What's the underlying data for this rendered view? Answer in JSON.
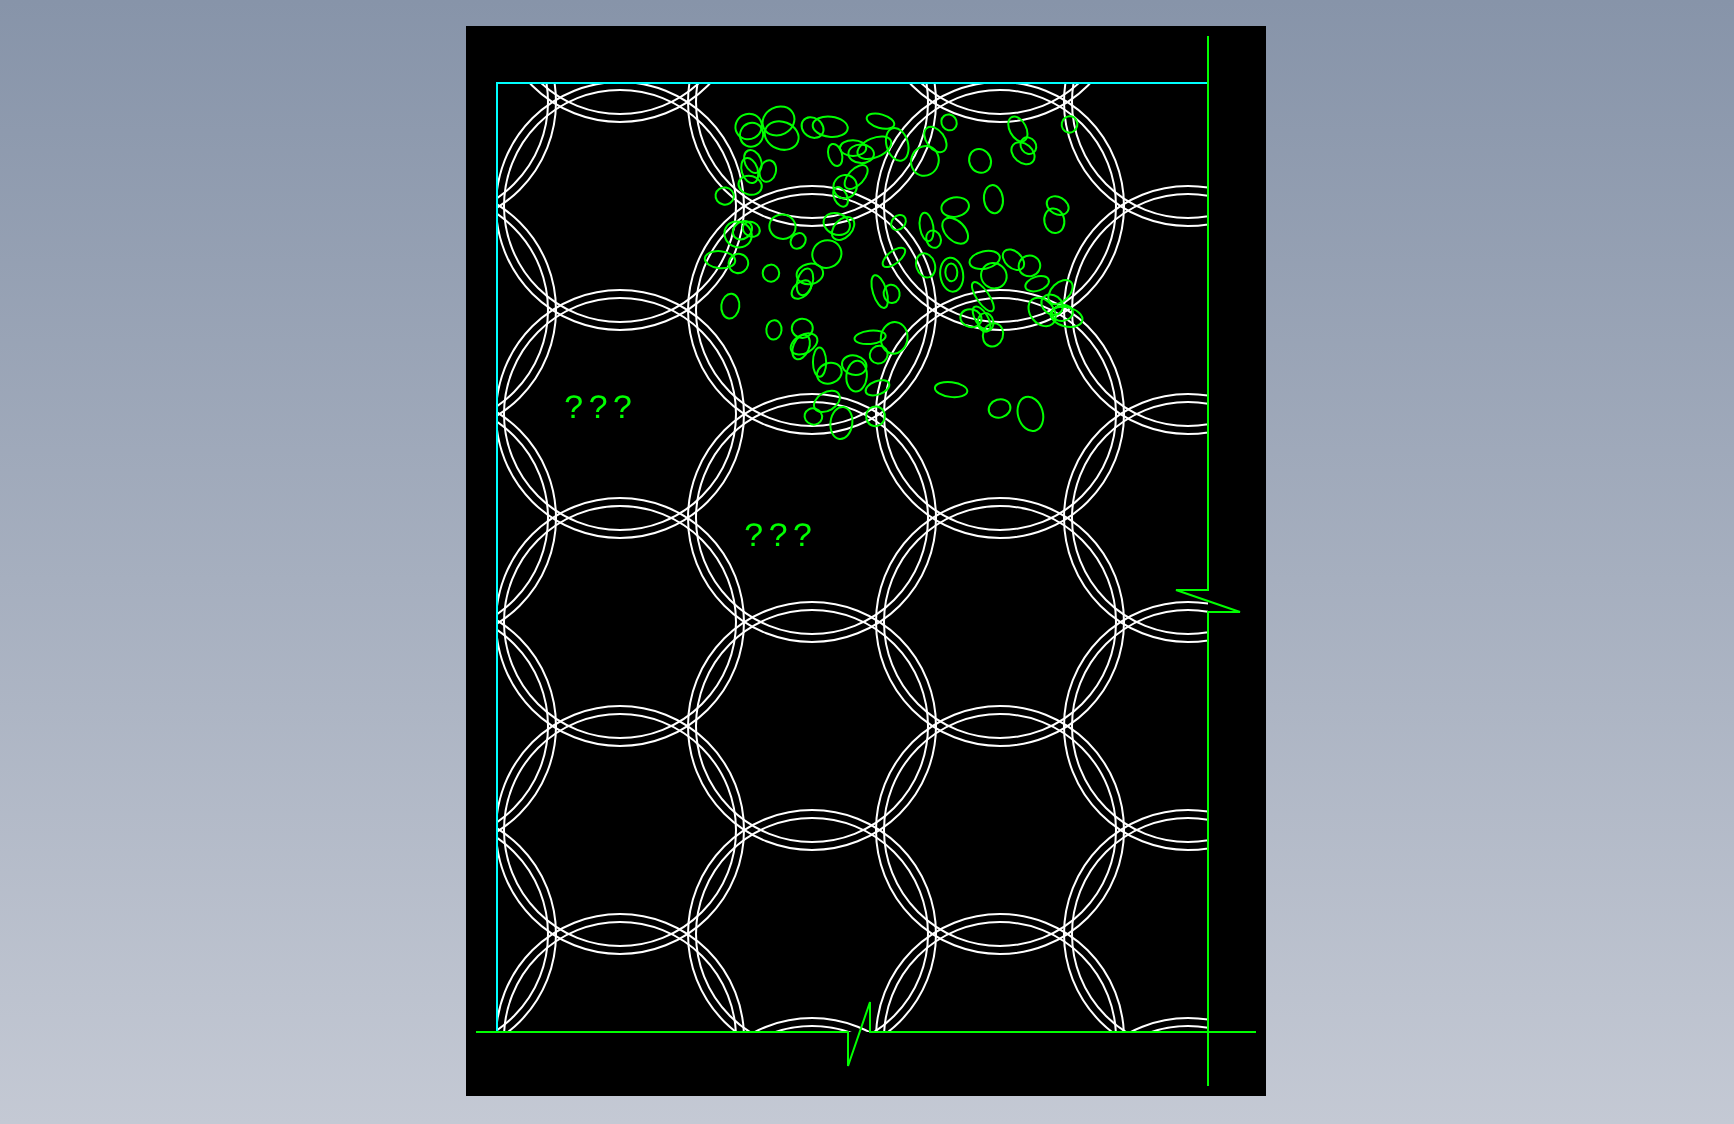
{
  "drawing": {
    "labels": [
      {
        "text": "???"
      },
      {
        "text": "???"
      }
    ]
  }
}
